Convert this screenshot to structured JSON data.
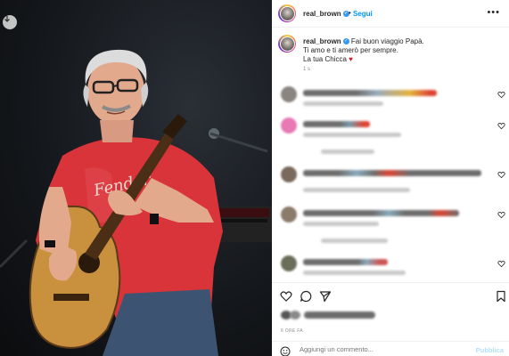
{
  "post": {
    "username": "real_brown",
    "verified": true,
    "follow_label": "Segui",
    "separator": "•",
    "more_label": "•••"
  },
  "caption": {
    "username": "real_brown",
    "line1": "Fai buon viaggio Papà.",
    "line2": "Ti amo e ti amerò per sempre.",
    "line3": "La tua Chicca",
    "heart": "♥",
    "time": "1 s"
  },
  "actions": {
    "icons": [
      "heart-icon",
      "comment-icon",
      "share-icon",
      "bookmark-icon"
    ],
    "time_ago": "6 ORE FA"
  },
  "add_comment": {
    "placeholder": "Aggiungi un commento...",
    "publish_label": "Pubblica",
    "emoji_icon": "smiley-icon"
  },
  "photo": {
    "download_icon": "download-icon"
  },
  "colors": {
    "link_blue": "#0095f6",
    "verified_blue": "#3897f0",
    "heart_red": "#d11c2e",
    "publish_disabled": "#b2dffc",
    "meta_gray": "#8e8e8e"
  }
}
